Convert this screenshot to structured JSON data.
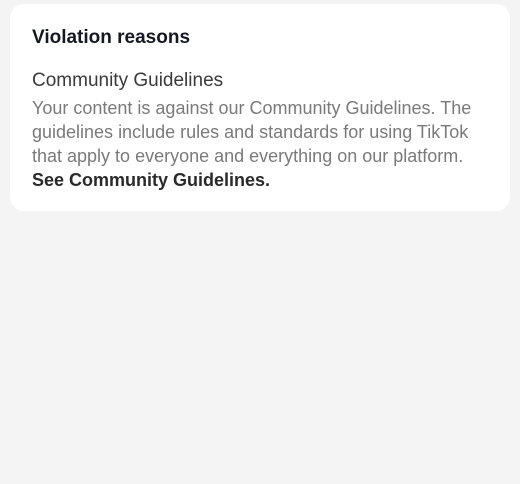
{
  "card": {
    "title": "Violation reasons",
    "reason": {
      "title": "Community Guidelines",
      "body": "Your content is against our Community Guidelines. The guidelines include rules and standards for using TikTok that apply to everyone and everything on our platform.",
      "link_label": "See Community Guidelines."
    }
  }
}
